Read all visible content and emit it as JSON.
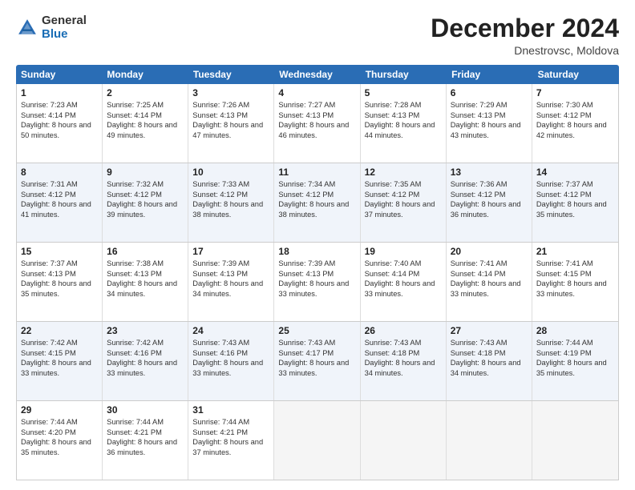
{
  "header": {
    "logo_general": "General",
    "logo_blue": "Blue",
    "month_title": "December 2024",
    "location": "Dnestrovsc, Moldova"
  },
  "weekdays": [
    "Sunday",
    "Monday",
    "Tuesday",
    "Wednesday",
    "Thursday",
    "Friday",
    "Saturday"
  ],
  "weeks": [
    [
      {
        "day": "1",
        "sunrise": "Sunrise: 7:23 AM",
        "sunset": "Sunset: 4:14 PM",
        "daylight": "Daylight: 8 hours and 50 minutes.",
        "alt": false
      },
      {
        "day": "2",
        "sunrise": "Sunrise: 7:25 AM",
        "sunset": "Sunset: 4:14 PM",
        "daylight": "Daylight: 8 hours and 49 minutes.",
        "alt": false
      },
      {
        "day": "3",
        "sunrise": "Sunrise: 7:26 AM",
        "sunset": "Sunset: 4:13 PM",
        "daylight": "Daylight: 8 hours and 47 minutes.",
        "alt": false
      },
      {
        "day": "4",
        "sunrise": "Sunrise: 7:27 AM",
        "sunset": "Sunset: 4:13 PM",
        "daylight": "Daylight: 8 hours and 46 minutes.",
        "alt": false
      },
      {
        "day": "5",
        "sunrise": "Sunrise: 7:28 AM",
        "sunset": "Sunset: 4:13 PM",
        "daylight": "Daylight: 8 hours and 44 minutes.",
        "alt": false
      },
      {
        "day": "6",
        "sunrise": "Sunrise: 7:29 AM",
        "sunset": "Sunset: 4:13 PM",
        "daylight": "Daylight: 8 hours and 43 minutes.",
        "alt": false
      },
      {
        "day": "7",
        "sunrise": "Sunrise: 7:30 AM",
        "sunset": "Sunset: 4:12 PM",
        "daylight": "Daylight: 8 hours and 42 minutes.",
        "alt": false
      }
    ],
    [
      {
        "day": "8",
        "sunrise": "Sunrise: 7:31 AM",
        "sunset": "Sunset: 4:12 PM",
        "daylight": "Daylight: 8 hours and 41 minutes.",
        "alt": true
      },
      {
        "day": "9",
        "sunrise": "Sunrise: 7:32 AM",
        "sunset": "Sunset: 4:12 PM",
        "daylight": "Daylight: 8 hours and 39 minutes.",
        "alt": true
      },
      {
        "day": "10",
        "sunrise": "Sunrise: 7:33 AM",
        "sunset": "Sunset: 4:12 PM",
        "daylight": "Daylight: 8 hours and 38 minutes.",
        "alt": true
      },
      {
        "day": "11",
        "sunrise": "Sunrise: 7:34 AM",
        "sunset": "Sunset: 4:12 PM",
        "daylight": "Daylight: 8 hours and 38 minutes.",
        "alt": true
      },
      {
        "day": "12",
        "sunrise": "Sunrise: 7:35 AM",
        "sunset": "Sunset: 4:12 PM",
        "daylight": "Daylight: 8 hours and 37 minutes.",
        "alt": true
      },
      {
        "day": "13",
        "sunrise": "Sunrise: 7:36 AM",
        "sunset": "Sunset: 4:12 PM",
        "daylight": "Daylight: 8 hours and 36 minutes.",
        "alt": true
      },
      {
        "day": "14",
        "sunrise": "Sunrise: 7:37 AM",
        "sunset": "Sunset: 4:12 PM",
        "daylight": "Daylight: 8 hours and 35 minutes.",
        "alt": true
      }
    ],
    [
      {
        "day": "15",
        "sunrise": "Sunrise: 7:37 AM",
        "sunset": "Sunset: 4:13 PM",
        "daylight": "Daylight: 8 hours and 35 minutes.",
        "alt": false
      },
      {
        "day": "16",
        "sunrise": "Sunrise: 7:38 AM",
        "sunset": "Sunset: 4:13 PM",
        "daylight": "Daylight: 8 hours and 34 minutes.",
        "alt": false
      },
      {
        "day": "17",
        "sunrise": "Sunrise: 7:39 AM",
        "sunset": "Sunset: 4:13 PM",
        "daylight": "Daylight: 8 hours and 34 minutes.",
        "alt": false
      },
      {
        "day": "18",
        "sunrise": "Sunrise: 7:39 AM",
        "sunset": "Sunset: 4:13 PM",
        "daylight": "Daylight: 8 hours and 33 minutes.",
        "alt": false
      },
      {
        "day": "19",
        "sunrise": "Sunrise: 7:40 AM",
        "sunset": "Sunset: 4:14 PM",
        "daylight": "Daylight: 8 hours and 33 minutes.",
        "alt": false
      },
      {
        "day": "20",
        "sunrise": "Sunrise: 7:41 AM",
        "sunset": "Sunset: 4:14 PM",
        "daylight": "Daylight: 8 hours and 33 minutes.",
        "alt": false
      },
      {
        "day": "21",
        "sunrise": "Sunrise: 7:41 AM",
        "sunset": "Sunset: 4:15 PM",
        "daylight": "Daylight: 8 hours and 33 minutes.",
        "alt": false
      }
    ],
    [
      {
        "day": "22",
        "sunrise": "Sunrise: 7:42 AM",
        "sunset": "Sunset: 4:15 PM",
        "daylight": "Daylight: 8 hours and 33 minutes.",
        "alt": true
      },
      {
        "day": "23",
        "sunrise": "Sunrise: 7:42 AM",
        "sunset": "Sunset: 4:16 PM",
        "daylight": "Daylight: 8 hours and 33 minutes.",
        "alt": true
      },
      {
        "day": "24",
        "sunrise": "Sunrise: 7:43 AM",
        "sunset": "Sunset: 4:16 PM",
        "daylight": "Daylight: 8 hours and 33 minutes.",
        "alt": true
      },
      {
        "day": "25",
        "sunrise": "Sunrise: 7:43 AM",
        "sunset": "Sunset: 4:17 PM",
        "daylight": "Daylight: 8 hours and 33 minutes.",
        "alt": true
      },
      {
        "day": "26",
        "sunrise": "Sunrise: 7:43 AM",
        "sunset": "Sunset: 4:18 PM",
        "daylight": "Daylight: 8 hours and 34 minutes.",
        "alt": true
      },
      {
        "day": "27",
        "sunrise": "Sunrise: 7:43 AM",
        "sunset": "Sunset: 4:18 PM",
        "daylight": "Daylight: 8 hours and 34 minutes.",
        "alt": true
      },
      {
        "day": "28",
        "sunrise": "Sunrise: 7:44 AM",
        "sunset": "Sunset: 4:19 PM",
        "daylight": "Daylight: 8 hours and 35 minutes.",
        "alt": true
      }
    ],
    [
      {
        "day": "29",
        "sunrise": "Sunrise: 7:44 AM",
        "sunset": "Sunset: 4:20 PM",
        "daylight": "Daylight: 8 hours and 35 minutes.",
        "alt": false
      },
      {
        "day": "30",
        "sunrise": "Sunrise: 7:44 AM",
        "sunset": "Sunset: 4:21 PM",
        "daylight": "Daylight: 8 hours and 36 minutes.",
        "alt": false
      },
      {
        "day": "31",
        "sunrise": "Sunrise: 7:44 AM",
        "sunset": "Sunset: 4:21 PM",
        "daylight": "Daylight: 8 hours and 37 minutes.",
        "alt": false
      },
      {
        "day": "",
        "sunrise": "",
        "sunset": "",
        "daylight": "",
        "alt": false,
        "empty": true
      },
      {
        "day": "",
        "sunrise": "",
        "sunset": "",
        "daylight": "",
        "alt": false,
        "empty": true
      },
      {
        "day": "",
        "sunrise": "",
        "sunset": "",
        "daylight": "",
        "alt": false,
        "empty": true
      },
      {
        "day": "",
        "sunrise": "",
        "sunset": "",
        "daylight": "",
        "alt": false,
        "empty": true
      }
    ]
  ]
}
